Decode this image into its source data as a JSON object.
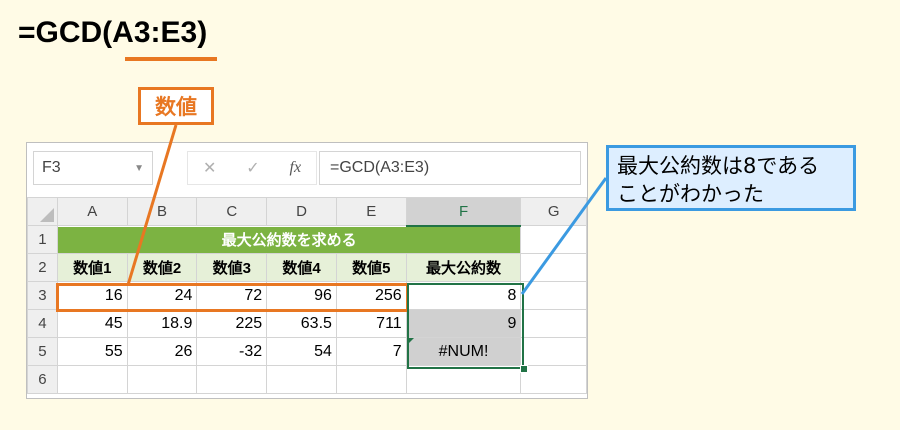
{
  "heading": {
    "formula": "=GCD(A3:E3)"
  },
  "callouts": {
    "argument_label": "数値",
    "result_line1": "最大公約数は8である",
    "result_line2": "ことがわかった"
  },
  "excel": {
    "name_box": "F3",
    "formula_bar": "=GCD(A3:E3)",
    "fx_label": "fx",
    "columns": [
      "A",
      "B",
      "C",
      "D",
      "E",
      "F",
      "G"
    ],
    "rows": [
      "1",
      "2",
      "3",
      "4",
      "5",
      "6"
    ],
    "title": "最大公約数を求める",
    "headers": [
      "数値1",
      "数値2",
      "数値3",
      "数値4",
      "数値5",
      "最大公約数"
    ],
    "data": [
      [
        "16",
        "24",
        "72",
        "96",
        "256",
        "8"
      ],
      [
        "45",
        "18.9",
        "225",
        "63.5",
        "711",
        "9"
      ],
      [
        "55",
        "26",
        "-32",
        "54",
        "7",
        "#NUM!"
      ]
    ]
  },
  "colors": {
    "orange": "#e87722",
    "blue": "#3b9ae1",
    "excel_green": "#217346",
    "title_green": "#7cb342"
  },
  "icons": [
    "cancel-icon",
    "enter-check-icon",
    "insert-function-icon",
    "dropdown-arrow-icon"
  ]
}
